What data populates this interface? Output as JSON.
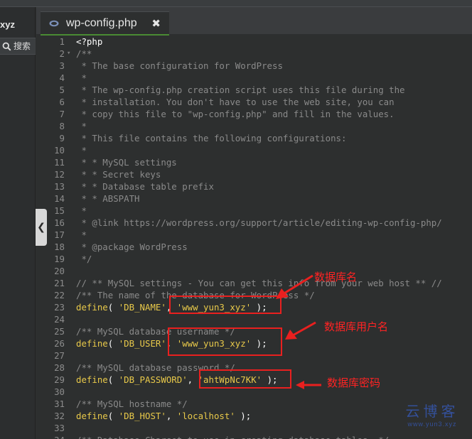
{
  "left_panel": {
    "tab_fragment": "xyz",
    "search_label": "搜索"
  },
  "editor": {
    "tab_title": "wp-config.php",
    "tab_close": "✖"
  },
  "lines": [
    {
      "n": "1",
      "fold": "",
      "parts": [
        {
          "t": "<?php",
          "c": "t-php"
        }
      ]
    },
    {
      "n": "2",
      "fold": "▾",
      "parts": [
        {
          "t": "/**",
          "c": "t-com"
        }
      ]
    },
    {
      "n": "3",
      "fold": "",
      "parts": [
        {
          "t": " * The base configuration for WordPress",
          "c": "t-com"
        }
      ]
    },
    {
      "n": "4",
      "fold": "",
      "parts": [
        {
          "t": " *",
          "c": "t-com"
        }
      ]
    },
    {
      "n": "5",
      "fold": "",
      "parts": [
        {
          "t": " * The wp-config.php creation script uses this file during the",
          "c": "t-com"
        }
      ]
    },
    {
      "n": "6",
      "fold": "",
      "parts": [
        {
          "t": " * installation. You don't have to use the web site, you can",
          "c": "t-com"
        }
      ]
    },
    {
      "n": "7",
      "fold": "",
      "parts": [
        {
          "t": " * copy this file to \"wp-config.php\" and fill in the values.",
          "c": "t-com"
        }
      ]
    },
    {
      "n": "8",
      "fold": "",
      "parts": [
        {
          "t": " *",
          "c": "t-com"
        }
      ]
    },
    {
      "n": "9",
      "fold": "",
      "parts": [
        {
          "t": " * This file contains the following configurations:",
          "c": "t-com"
        }
      ]
    },
    {
      "n": "10",
      "fold": "",
      "parts": [
        {
          "t": " *",
          "c": "t-com"
        }
      ]
    },
    {
      "n": "11",
      "fold": "",
      "parts": [
        {
          "t": " * * MySQL settings",
          "c": "t-com"
        }
      ]
    },
    {
      "n": "12",
      "fold": "",
      "parts": [
        {
          "t": " * * Secret keys",
          "c": "t-com"
        }
      ]
    },
    {
      "n": "13",
      "fold": "",
      "parts": [
        {
          "t": " * * Database table prefix",
          "c": "t-com"
        }
      ]
    },
    {
      "n": "14",
      "fold": "",
      "parts": [
        {
          "t": " * * ABSPATH",
          "c": "t-com"
        }
      ]
    },
    {
      "n": "15",
      "fold": "",
      "parts": [
        {
          "t": " *",
          "c": "t-com"
        }
      ]
    },
    {
      "n": "16",
      "fold": "",
      "parts": [
        {
          "t": " * @link https://wordpress.org/support/article/editing-wp-config-php/",
          "c": "t-com"
        }
      ]
    },
    {
      "n": "17",
      "fold": "",
      "parts": [
        {
          "t": " *",
          "c": "t-com"
        }
      ]
    },
    {
      "n": "18",
      "fold": "",
      "parts": [
        {
          "t": " * @package WordPress",
          "c": "t-com"
        }
      ]
    },
    {
      "n": "19",
      "fold": "",
      "parts": [
        {
          "t": " */",
          "c": "t-com"
        }
      ]
    },
    {
      "n": "20",
      "fold": "",
      "parts": []
    },
    {
      "n": "21",
      "fold": "",
      "parts": [
        {
          "t": "// ** MySQL settings - You can get this info from your web host ** //",
          "c": "t-com"
        }
      ]
    },
    {
      "n": "22",
      "fold": "",
      "parts": [
        {
          "t": "/** The name of the database for WordPress */",
          "c": "t-com"
        }
      ]
    },
    {
      "n": "23",
      "fold": "",
      "parts": [
        {
          "t": "define",
          "c": "t-fn"
        },
        {
          "t": "( ",
          "c": "t-pl"
        },
        {
          "t": "'DB_NAME'",
          "c": "t-str"
        },
        {
          "t": ", ",
          "c": "t-pl"
        },
        {
          "t": "'www_yun3_xyz'",
          "c": "t-str"
        },
        {
          "t": " );",
          "c": "t-pl"
        }
      ]
    },
    {
      "n": "24",
      "fold": "",
      "parts": []
    },
    {
      "n": "25",
      "fold": "",
      "parts": [
        {
          "t": "/** MySQL database username */",
          "c": "t-com"
        }
      ]
    },
    {
      "n": "26",
      "fold": "",
      "parts": [
        {
          "t": "define",
          "c": "t-fn"
        },
        {
          "t": "( ",
          "c": "t-pl"
        },
        {
          "t": "'DB_USER'",
          "c": "t-str"
        },
        {
          "t": ", ",
          "c": "t-pl"
        },
        {
          "t": "'www_yun3_xyz'",
          "c": "t-str"
        },
        {
          "t": " );",
          "c": "t-pl"
        }
      ]
    },
    {
      "n": "27",
      "fold": "",
      "parts": []
    },
    {
      "n": "28",
      "fold": "",
      "parts": [
        {
          "t": "/** MySQL database password */",
          "c": "t-com"
        }
      ]
    },
    {
      "n": "29",
      "fold": "",
      "parts": [
        {
          "t": "define",
          "c": "t-fn"
        },
        {
          "t": "( ",
          "c": "t-pl"
        },
        {
          "t": "'DB_PASSWORD'",
          "c": "t-str"
        },
        {
          "t": ", ",
          "c": "t-pl"
        },
        {
          "t": "'ahtWpNc7KK'",
          "c": "t-str"
        },
        {
          "t": " );",
          "c": "t-pl"
        }
      ]
    },
    {
      "n": "30",
      "fold": "",
      "parts": []
    },
    {
      "n": "31",
      "fold": "",
      "parts": [
        {
          "t": "/** MySQL hostname */",
          "c": "t-com"
        }
      ]
    },
    {
      "n": "32",
      "fold": "",
      "parts": [
        {
          "t": "define",
          "c": "t-fn"
        },
        {
          "t": "( ",
          "c": "t-pl"
        },
        {
          "t": "'DB_HOST'",
          "c": "t-str"
        },
        {
          "t": ", ",
          "c": "t-pl"
        },
        {
          "t": "'localhost'",
          "c": "t-str"
        },
        {
          "t": " );",
          "c": "t-pl"
        }
      ]
    },
    {
      "n": "33",
      "fold": "",
      "parts": []
    },
    {
      "n": "34",
      "fold": "",
      "parts": [
        {
          "t": "/** Database Charset to use in creating database tables. */",
          "c": "t-com"
        }
      ]
    }
  ],
  "annotations": {
    "db_name": "数据库名",
    "db_user": "数据库用户名",
    "db_password": "数据库密码"
  },
  "watermark": {
    "main": "云博客",
    "sub": "www.yun3.xyz"
  },
  "colors": {
    "background": "#2d2f2f",
    "keyword_yellow": "#e8c94a",
    "comment_gray": "#8a8a8a",
    "annotation_red": "#ff2323",
    "tab_accent": "#4a8b33"
  }
}
